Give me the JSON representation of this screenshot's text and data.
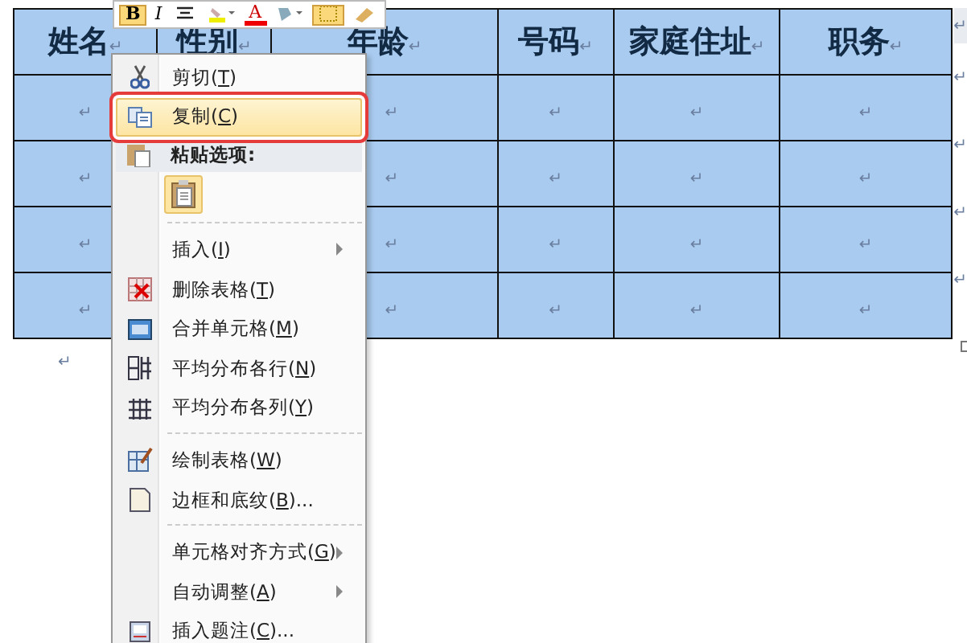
{
  "toolbar": [
    {
      "kind": "bold",
      "label": "B",
      "selected": true
    },
    {
      "kind": "italic",
      "label": "I",
      "selected": false
    },
    {
      "kind": "align",
      "selected": false
    },
    {
      "kind": "highlight",
      "selected": false
    },
    {
      "kind": "fontcolor",
      "label": "A",
      "selected": false
    },
    {
      "kind": "shading",
      "selected": false
    },
    {
      "kind": "borders",
      "selected": true
    },
    {
      "kind": "eraser",
      "selected": false
    }
  ],
  "table": {
    "columns": [
      {
        "label": "姓名",
        "mark": "↵"
      },
      {
        "label": "性别",
        "mark": "↵"
      },
      {
        "label": "年龄",
        "mark": "↵"
      },
      {
        "label": "号码",
        "mark": "↵"
      },
      {
        "label": "家庭住址",
        "mark": "↵"
      },
      {
        "label": "职务",
        "mark": "↵"
      }
    ],
    "rows": [
      {
        "cells": [
          "↵",
          null,
          "↵",
          "↵",
          "↵",
          "↵"
        ],
        "end": "↵"
      },
      {
        "cells": [
          "↵",
          null,
          "↵",
          "↵",
          "↵",
          "↵"
        ],
        "end": "↵"
      },
      {
        "cells": [
          "↵",
          null,
          "↵",
          "↵",
          "↵",
          "↵"
        ],
        "end": "↵"
      },
      {
        "cells": [
          "↵",
          null,
          "↵",
          "↵",
          "↵",
          "↵"
        ],
        "end": "↵"
      }
    ],
    "header_end": "↵"
  },
  "after_table": "↵",
  "context_menu": [
    {
      "kind": "item",
      "pre": "剪切(",
      "key": "T",
      "post": ")",
      "selected": false
    },
    {
      "kind": "item",
      "pre": "复制(",
      "key": "C",
      "post": ")",
      "selected": true
    },
    {
      "kind": "header",
      "label": "粘贴选项:"
    },
    {
      "kind": "paste"
    },
    {
      "kind": "separator"
    },
    {
      "kind": "item",
      "pre": "插入(",
      "key": "I",
      "post": ")",
      "submenu": true,
      "selected": false
    },
    {
      "kind": "item",
      "pre": "删除表格(",
      "key": "T",
      "post": ")",
      "selected": false
    },
    {
      "kind": "item",
      "pre": "合并单元格(",
      "key": "M",
      "post": ")",
      "selected": false
    },
    {
      "kind": "item",
      "pre": "平均分布各行(",
      "key": "N",
      "post": ")",
      "selected": false
    },
    {
      "kind": "item",
      "pre": "平均分布各列(",
      "key": "Y",
      "post": ")",
      "selected": false
    },
    {
      "kind": "separator"
    },
    {
      "kind": "item",
      "pre": "绘制表格(",
      "key": "W",
      "post": ")",
      "selected": false
    },
    {
      "kind": "item",
      "pre": "边框和底纹(",
      "key": "B",
      "post": ")...",
      "selected": false
    },
    {
      "kind": "separator"
    },
    {
      "kind": "item",
      "pre": "单元格对齐方式(",
      "key": "G",
      "post": ")",
      "submenu": true,
      "selected": false
    },
    {
      "kind": "item",
      "pre": "自动调整(",
      "key": "A",
      "post": ")",
      "submenu": true,
      "selected": false
    },
    {
      "kind": "item",
      "pre": "插入题注(",
      "key": "C",
      "post": ")...",
      "selected": false
    }
  ],
  "highlight_box": true
}
